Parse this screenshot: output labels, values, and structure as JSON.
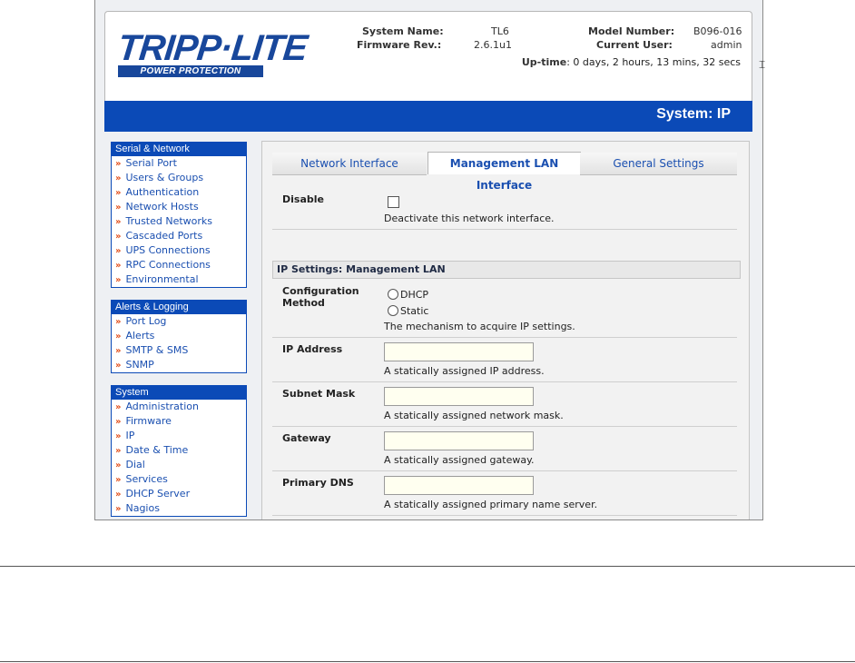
{
  "header": {
    "logo_main": "TRIPP·LITE",
    "logo_sub": "POWER PROTECTION",
    "system_name_label": "System Name:",
    "system_name": "TL6",
    "firmware_label": "Firmware Rev.:",
    "firmware": "2.6.1u1",
    "model_label": "Model Number:",
    "model": "B096-016",
    "user_label": "Current User:",
    "user": "admin",
    "uptime_label": "Up-time",
    "uptime": ": 0 days, 2 hours, 13 mins, 32 secs"
  },
  "page_title": "System: IP",
  "sidebar": {
    "groups": [
      {
        "title": "Serial & Network",
        "items": [
          "Serial Port",
          "Users & Groups",
          "Authentication",
          "Network Hosts",
          "Trusted Networks",
          "Cascaded Ports",
          "UPS Connections",
          "RPC Connections",
          "Environmental"
        ]
      },
      {
        "title": "Alerts & Logging",
        "items": [
          "Port Log",
          "Alerts",
          "SMTP & SMS",
          "SNMP"
        ]
      },
      {
        "title": "System",
        "items": [
          "Administration",
          "Firmware",
          "IP",
          "Date & Time",
          "Dial",
          "Services",
          "DHCP Server",
          "Nagios"
        ]
      }
    ]
  },
  "tabs": [
    "Network Interface",
    "Management LAN Interface",
    "General Settings"
  ],
  "active_tab": 1,
  "form": {
    "disable_label": "Disable",
    "disable_help": "Deactivate this network interface.",
    "section_title": "IP Settings: Management LAN",
    "config_label": "Configuration Method",
    "dhcp": "DHCP",
    "static": "Static",
    "config_help": "The mechanism to acquire IP settings.",
    "ip_label": "IP Address",
    "ip_help": "A statically assigned IP address.",
    "mask_label": "Subnet Mask",
    "mask_help": "A statically assigned network mask.",
    "gateway_label": "Gateway",
    "gateway_help": "A statically assigned gateway.",
    "dns_label": "Primary DNS",
    "dns_help": "A statically assigned primary name server."
  },
  "colors": {
    "brand_blue": "#0b4ab7",
    "link": "#1a4fb0",
    "bullet": "#e14b16"
  }
}
